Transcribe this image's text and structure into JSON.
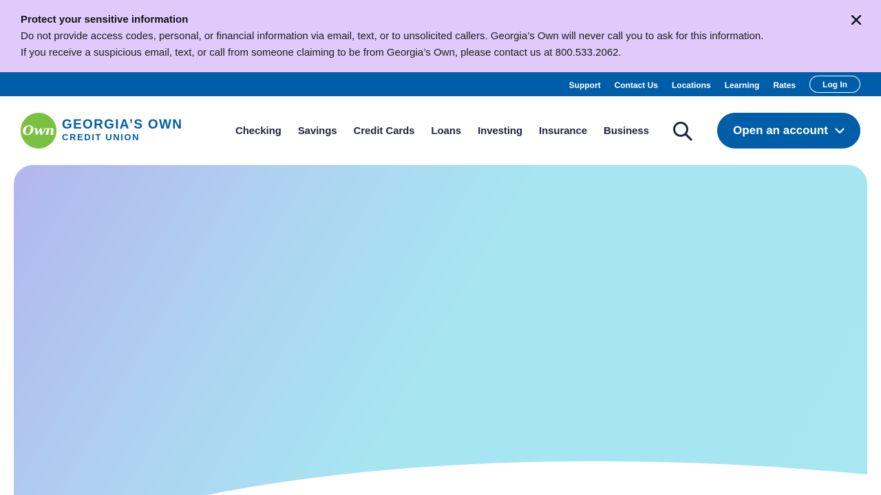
{
  "alert": {
    "title": "Protect your sensitive information",
    "body": "Do not provide access codes, personal, or financial information via email, text, or to unsolicited callers. Georgia’s Own will never call you to ask for this information. If you receive a suspicious email, text, or call from someone claiming to be from Georgia’s Own, please contact us at 800.533.2062.",
    "close_icon": "close-icon"
  },
  "utility": {
    "links": [
      "Support",
      "Contact Us",
      "Locations",
      "Learning",
      "Rates"
    ],
    "login_label": "Log In"
  },
  "logo": {
    "mark_text": "Own",
    "line1": "GEORGIA’S OWN",
    "line2": "CREDIT UNION",
    "mark_color": "#7bc043",
    "brand_color": "#005ea8"
  },
  "nav": {
    "items": [
      "Checking",
      "Savings",
      "Credit Cards",
      "Loans",
      "Investing",
      "Insurance",
      "Business"
    ],
    "search_icon": "search-icon",
    "cta_label": "Open an account",
    "cta_icon": "chevron-down-icon"
  },
  "colors": {
    "alert_bg": "#e2c9fb",
    "utility_bg": "#005ea8",
    "primary": "#005ea8",
    "hero_gradient_start": "#b2b6ee",
    "hero_gradient_end": "#a6e7f2"
  }
}
